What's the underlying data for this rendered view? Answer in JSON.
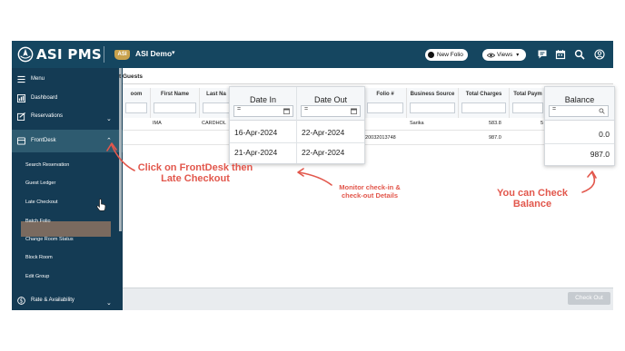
{
  "app": {
    "logo_text": "ASI PMS",
    "hotel_badge": "ASI",
    "hotel_name": "ASI Demo"
  },
  "topbar": {
    "new_folio_label": "New Folio",
    "views_label": "Views"
  },
  "sidebar": {
    "menu_label": "Menu",
    "dashboard_label": "Dashboard",
    "reservations_label": "Reservations",
    "frontdesk_label": "FrontDesk",
    "sub_items": [
      "Search Reservation",
      "Guest Ledger",
      "Late Checkout",
      "Batch Folio",
      "Change Room Status",
      "Block Room",
      "Edit Group"
    ],
    "rate_label": "Rate & Availability"
  },
  "page": {
    "subtitle": "t Guests"
  },
  "grid": {
    "headers": [
      "oom",
      "First Name",
      "Last Na",
      "Folio #",
      "Business Source",
      "Total Charges",
      "Total Paym"
    ],
    "rows": [
      {
        "first_name": "IMA",
        "last_name": "CARDHOL",
        "folio": "",
        "source": "Sarika",
        "total_charges": "583.8",
        "total_paym": "5"
      },
      {
        "first_name": "",
        "last_name": "",
        "folio": "420032013748",
        "source": "",
        "total_charges": "987.0",
        "total_paym": ""
      }
    ],
    "checkout_label": "Check Out"
  },
  "zoom_dates": {
    "date_in_label": "Date In",
    "date_out_label": "Date Out",
    "rows": [
      {
        "date_in": "16-Apr-2024",
        "date_out": "22-Apr-2024"
      },
      {
        "date_in": "21-Apr-2024",
        "date_out": "22-Apr-2024"
      }
    ]
  },
  "zoom_balance": {
    "label": "Balance",
    "values": [
      "0.0",
      "987.0"
    ]
  },
  "annotations": {
    "frontdesk_line1": "Click on FrontDesk then",
    "frontdesk_line2": "Late Checkout",
    "monitor_line1": "Monitor check-in &",
    "monitor_line2": "check-out Details",
    "balance_line1": "You can Check",
    "balance_line2": "Balance"
  },
  "colors": {
    "topbar": "#154660",
    "sidebar": "#143b54",
    "annotation": "#e2574c",
    "logo_badge": "#c9a24d"
  },
  "icons": [
    "globe-icon",
    "chevron-down-icon",
    "eye-icon",
    "message-icon",
    "calendar-icon",
    "search-icon",
    "user-circle-icon",
    "menu-icon",
    "dashboard-icon",
    "reservations-icon",
    "frontdesk-icon",
    "rate-icon",
    "cursor-hand-icon"
  ]
}
